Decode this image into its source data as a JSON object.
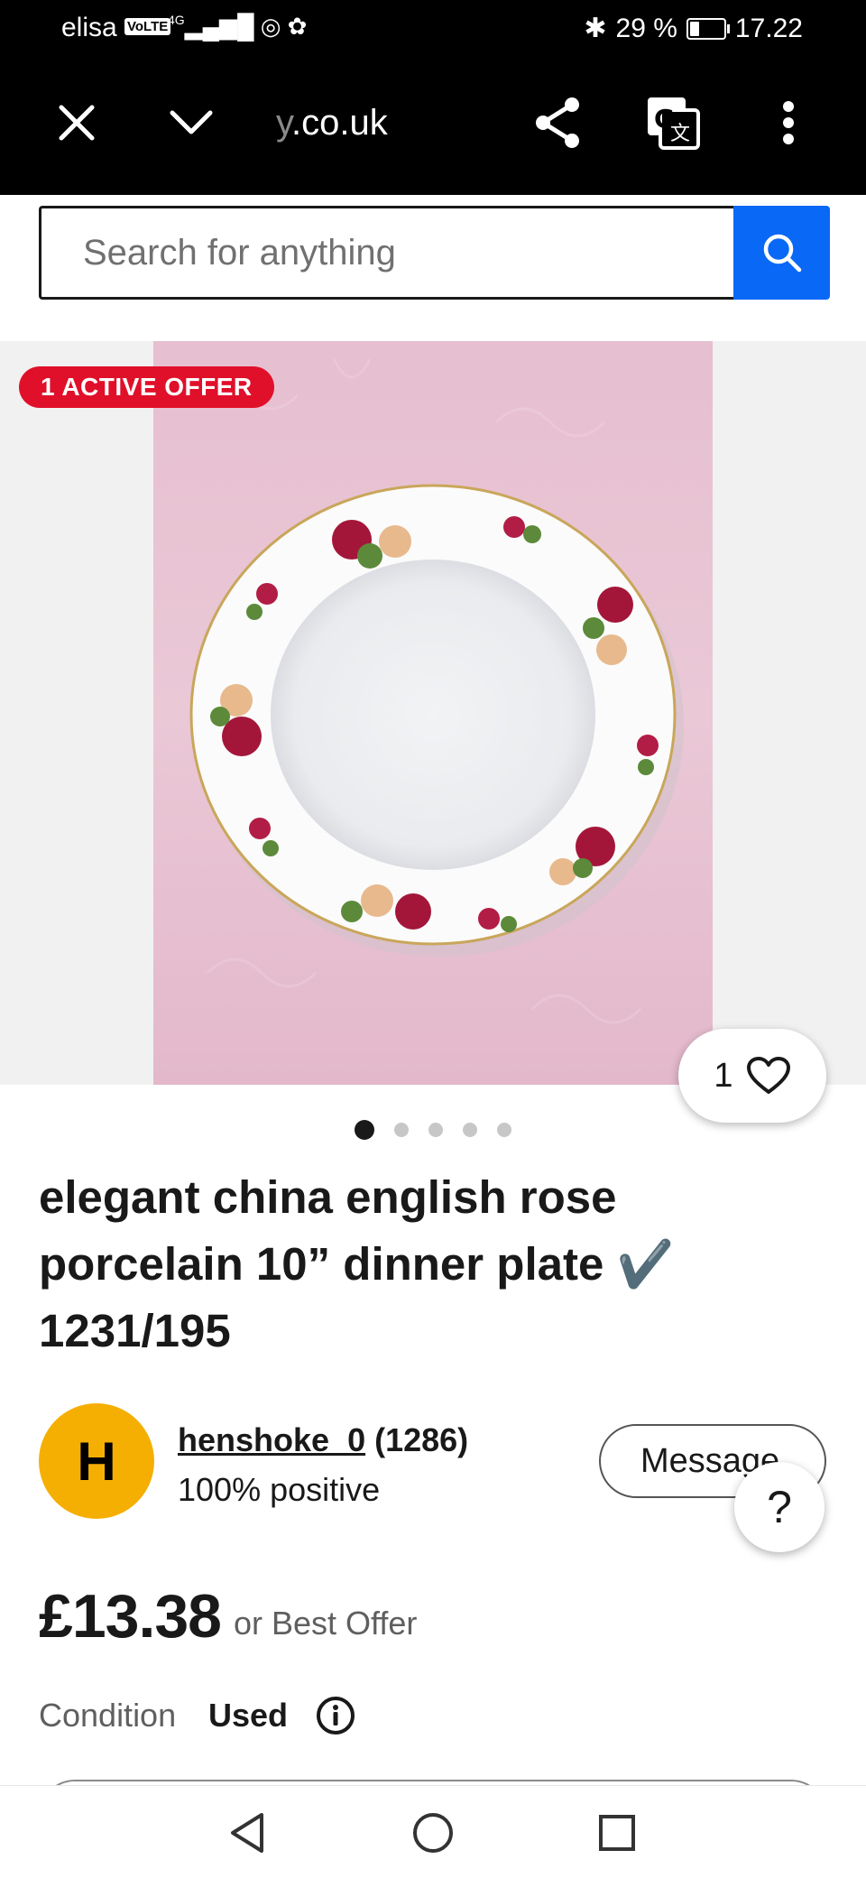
{
  "status_bar": {
    "carrier": "elisa",
    "volte": "VoLTE",
    "network": "4G",
    "battery": "29 %",
    "time": "17.22"
  },
  "browser": {
    "url_faded": "y",
    "url": ".co.uk",
    "icons": [
      "close-icon",
      "chevron-down-icon",
      "share-icon",
      "translate-icon",
      "more-vertical-icon"
    ]
  },
  "search": {
    "placeholder": "Search for anything"
  },
  "gallery": {
    "offer_badge": "1 ACTIVE OFFER",
    "watch_count": "1",
    "image_count": 5,
    "active_index": 0
  },
  "listing": {
    "title": "elegant china english rose porcelain 10” dinner plate",
    "title_mark": "✔️",
    "title_code": "1231/195",
    "price": "£13.38",
    "best_offer": "or Best Offer",
    "condition_label": "Condition",
    "condition_value": "Used"
  },
  "seller": {
    "initial": "H",
    "username": "henshoke_0",
    "feedback_count": "(1286)",
    "positive": "100% positive",
    "message_label": "Message"
  },
  "help": {
    "label": "?"
  },
  "colors": {
    "accent_blue": "#0968f6",
    "offer_red": "#e0102a",
    "avatar_yellow": "#f5af02"
  }
}
